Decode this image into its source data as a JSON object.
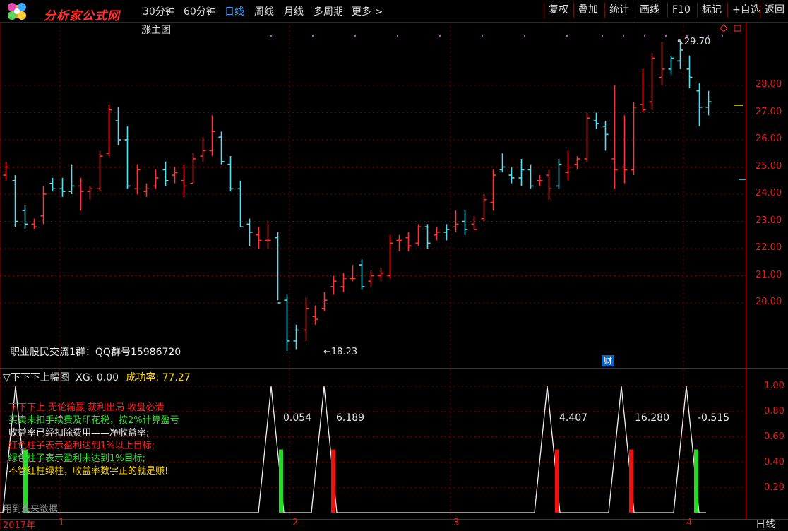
{
  "toolbar": {
    "logo_text": "分析家公式网",
    "logo_url": "www.88gs.com",
    "periods": [
      "30分钟",
      "60分钟",
      "日线",
      "周线",
      "月线",
      "多周期",
      "更多"
    ],
    "active_period": "日线",
    "more_arrow": ">",
    "right_buttons": [
      "复权",
      "叠加",
      "统计",
      "画线",
      "F10",
      "标记",
      "+自选",
      "返回"
    ]
  },
  "main_chart": {
    "title_suffix": "涨主图",
    "high_label": "29.70",
    "low_label": "18.23",
    "group_text": "职业股民交流1群：QQ群号15986720",
    "finance_badge": "财",
    "y_ticks": [
      "28.00",
      "27.00",
      "26.00",
      "25.00",
      "24.00",
      "23.00",
      "22.00",
      "21.00",
      "20.00"
    ],
    "colors": {
      "up": "#ff3333",
      "down": "#54e0f0",
      "grid": "#800000",
      "axis": "#c00000"
    }
  },
  "chart_data": {
    "type": "candlestick",
    "ylim": [
      18.0,
      30.2
    ],
    "candles": [
      [
        24.7,
        25.2,
        24.5,
        25.0,
        1
      ],
      [
        24.5,
        24.7,
        22.8,
        23.0,
        0
      ],
      [
        23.4,
        23.6,
        22.7,
        22.9,
        0
      ],
      [
        22.9,
        23.1,
        22.7,
        22.8,
        1
      ],
      [
        23.2,
        24.3,
        22.9,
        24.0,
        1
      ],
      [
        24.4,
        24.6,
        24.1,
        24.2,
        0
      ],
      [
        24.2,
        24.6,
        23.9,
        24.1,
        0
      ],
      [
        24.1,
        25.1,
        24.0,
        24.3,
        0
      ],
      [
        24.3,
        24.6,
        23.4,
        24.1,
        1
      ],
      [
        24.1,
        24.3,
        23.8,
        24.2,
        1
      ],
      [
        24.2,
        25.6,
        24.1,
        25.4,
        1
      ],
      [
        25.5,
        27.3,
        25.4,
        27.1,
        1
      ],
      [
        26.7,
        27.2,
        25.8,
        26.0,
        0
      ],
      [
        26.0,
        26.5,
        24.2,
        24.3,
        0
      ],
      [
        24.2,
        25.1,
        24.0,
        24.9,
        1
      ],
      [
        24.1,
        24.4,
        23.9,
        24.2,
        1
      ],
      [
        24.3,
        24.9,
        24.2,
        24.6,
        1
      ],
      [
        24.9,
        25.2,
        24.3,
        24.5,
        0
      ],
      [
        24.7,
        25.0,
        24.4,
        24.8,
        1
      ],
      [
        24.5,
        25.1,
        23.9,
        24.3,
        1
      ],
      [
        24.4,
        25.5,
        24.4,
        25.3,
        1
      ],
      [
        25.4,
        26.1,
        25.2,
        25.6,
        1
      ],
      [
        25.6,
        26.9,
        25.4,
        26.3,
        1
      ],
      [
        26.1,
        26.3,
        25.1,
        25.2,
        0
      ],
      [
        25.1,
        25.4,
        24.1,
        24.2,
        0
      ],
      [
        24.2,
        24.5,
        22.8,
        22.8,
        0
      ],
      [
        22.9,
        23.1,
        22.1,
        22.6,
        0
      ],
      [
        22.5,
        22.8,
        22.0,
        22.3,
        1
      ],
      [
        22.3,
        23.0,
        22.0,
        22.3,
        1
      ],
      [
        22.4,
        22.6,
        20.1,
        20.0,
        0
      ],
      [
        20.1,
        20.3,
        18.23,
        18.6,
        0
      ],
      [
        18.6,
        19.2,
        18.3,
        19.0,
        0
      ],
      [
        19.0,
        20.2,
        18.6,
        19.8,
        1
      ],
      [
        19.5,
        19.9,
        19.2,
        19.4,
        1
      ],
      [
        19.8,
        20.4,
        19.7,
        20.1,
        1
      ],
      [
        20.6,
        21.0,
        20.3,
        20.8,
        1
      ],
      [
        20.6,
        21.1,
        20.4,
        20.9,
        1
      ],
      [
        20.9,
        21.4,
        20.8,
        20.9,
        1
      ],
      [
        21.4,
        21.6,
        20.5,
        20.6,
        0
      ],
      [
        20.8,
        21.2,
        20.6,
        21.0,
        1
      ],
      [
        21.0,
        21.3,
        20.8,
        21.1,
        1
      ],
      [
        21.0,
        22.5,
        20.9,
        22.2,
        1
      ],
      [
        22.3,
        22.5,
        21.9,
        22.3,
        1
      ],
      [
        22.4,
        22.6,
        21.9,
        22.1,
        1
      ],
      [
        22.2,
        22.9,
        22.1,
        22.8,
        1
      ],
      [
        22.8,
        22.9,
        22.0,
        22.2,
        0
      ],
      [
        22.5,
        22.8,
        22.3,
        22.6,
        1
      ],
      [
        22.6,
        22.9,
        22.3,
        22.7,
        0
      ],
      [
        22.8,
        23.4,
        22.6,
        22.9,
        1
      ],
      [
        23.0,
        23.4,
        22.5,
        22.7,
        0
      ],
      [
        22.9,
        23.2,
        22.7,
        22.7,
        1
      ],
      [
        23.1,
        24.0,
        23.0,
        23.8,
        1
      ],
      [
        23.7,
        24.9,
        23.4,
        24.7,
        1
      ],
      [
        24.9,
        25.5,
        24.8,
        25.0,
        0
      ],
      [
        24.7,
        25.0,
        24.4,
        24.6,
        0
      ],
      [
        24.6,
        25.3,
        24.3,
        24.9,
        0
      ],
      [
        24.9,
        25.1,
        24.2,
        24.3,
        0
      ],
      [
        24.5,
        24.7,
        24.3,
        24.5,
        1
      ],
      [
        24.7,
        24.9,
        23.8,
        24.2,
        1
      ],
      [
        24.3,
        25.3,
        24.2,
        25.1,
        0
      ],
      [
        24.8,
        25.6,
        24.5,
        25.0,
        1
      ],
      [
        25.1,
        25.4,
        24.9,
        25.3,
        1
      ],
      [
        25.3,
        27.0,
        25.2,
        26.8,
        1
      ],
      [
        26.7,
        27.0,
        26.4,
        26.6,
        0
      ],
      [
        26.5,
        26.7,
        25.6,
        26.2,
        0
      ],
      [
        25.3,
        28.0,
        24.2,
        24.9,
        1
      ],
      [
        25.0,
        26.9,
        24.4,
        24.9,
        1
      ],
      [
        24.9,
        27.4,
        24.7,
        27.2,
        1
      ],
      [
        27.3,
        28.6,
        27.0,
        27.1,
        1
      ],
      [
        27.4,
        29.2,
        27.1,
        29.0,
        1
      ],
      [
        28.3,
        29.6,
        28.0,
        28.6,
        1
      ],
      [
        28.6,
        29.1,
        28.4,
        29.0,
        0
      ],
      [
        28.9,
        29.7,
        28.6,
        29.3,
        0
      ],
      [
        28.6,
        29.1,
        27.9,
        28.3,
        0
      ],
      [
        27.8,
        28.1,
        26.5,
        27.2,
        0
      ],
      [
        27.2,
        27.8,
        26.9,
        27.4,
        0
      ]
    ],
    "sub": {
      "indicator_name": "下下下上幅图",
      "xg_label": "XG:",
      "xg_value": "0.00",
      "rate_label": "成功率:",
      "rate_value": "77.27",
      "ylim": [
        0,
        1.08
      ],
      "y_ticks": [
        "1.00",
        "0.80",
        "0.60",
        "0.40",
        "0.20"
      ],
      "signal_values": [
        "0.054",
        "6.189",
        "4.407",
        "16.280",
        "-0.515"
      ],
      "bars": [
        {
          "color": "green",
          "height": 0.5
        },
        {
          "color": "green",
          "height": 0.5
        },
        {
          "color": "red",
          "height": 0.5
        },
        {
          "color": "red",
          "height": 0.5
        },
        {
          "color": "red",
          "height": 0.5
        },
        {
          "color": "green",
          "height": 0.5
        }
      ]
    },
    "x_ticks": [
      "2017年",
      "1",
      "2",
      "3",
      "4"
    ]
  },
  "legend": {
    "line1": "下下下上 无论输赢 获利出局 收盘必清",
    "line2": "买卖未扣手续费及印花税，按2%计算盈亏",
    "line3": "收益率已经扣除费用——净收益率;",
    "line4": "红色柱子表示盈利达到1%以上目标;",
    "line5": "绿色柱子表示盈利未达到1%目标;",
    "line6": "不管红柱绿柱，收益率数字正的就是赚!",
    "line7": "用到未来数据"
  },
  "status": {
    "period_label": "日线"
  }
}
